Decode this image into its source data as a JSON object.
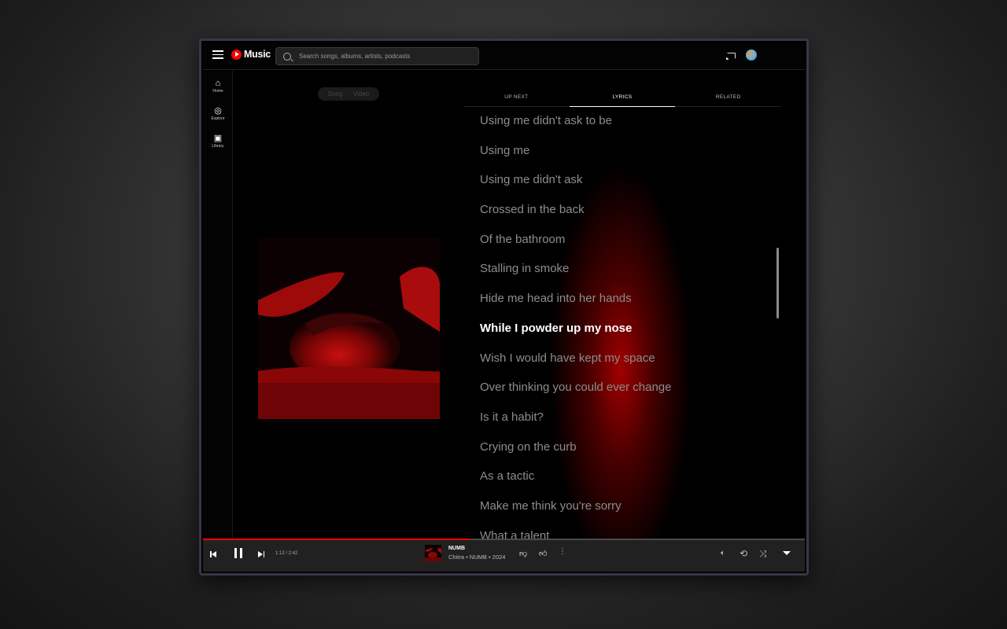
{
  "app": {
    "brand": "Music",
    "brand_color": "#ff0000"
  },
  "search": {
    "placeholder": "Search songs, albums, artists, podcasts"
  },
  "sidebar": {
    "items": [
      {
        "label": "Home",
        "icon": "home-icon"
      },
      {
        "label": "Explore",
        "icon": "compass-icon"
      },
      {
        "label": "Library",
        "icon": "library-icon"
      }
    ]
  },
  "player_view": {
    "toggle": [
      "Song",
      "Video"
    ]
  },
  "tabs": [
    {
      "label": "UP NEXT"
    },
    {
      "label": "LYRICS",
      "active": true
    },
    {
      "label": "RELATED"
    }
  ],
  "lyrics": {
    "lines": [
      "Using me didn't ask to be",
      "Using me",
      "Using me didn't ask",
      "Crossed in the back",
      "Of the bathroom",
      "Stalling in smoke",
      "Hide me head into her hands",
      "While I powder up my nose",
      "Wish I would have kept my space",
      "Over thinking you could ever change",
      "Is it a habit?",
      "Crying on the curb",
      "As a tactic",
      "Make me think you're sorry",
      "What a talent"
    ],
    "current_index": 7
  },
  "player": {
    "time": "1:12 / 2:42",
    "progress": 0.444,
    "track_title": "NUMB",
    "track_subtitle": "Chitra • NUMB • 2024",
    "progress_color": "#ff0000"
  }
}
